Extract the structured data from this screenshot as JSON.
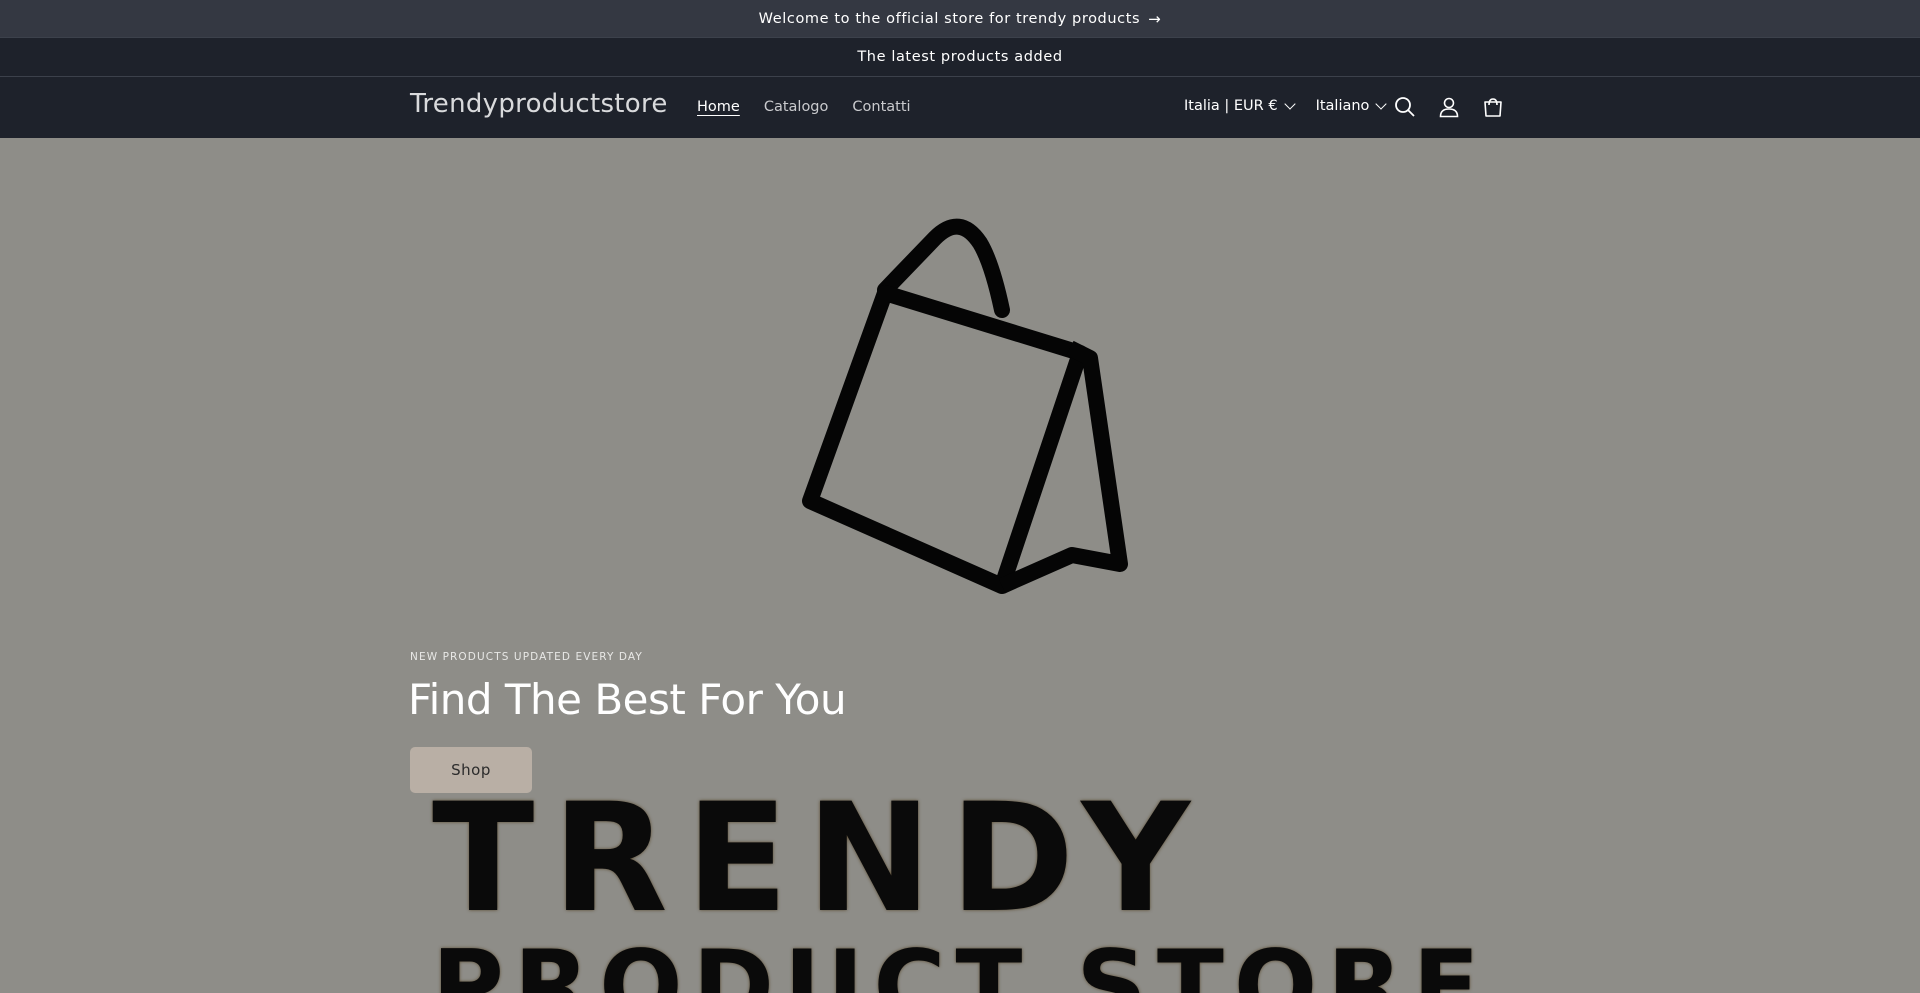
{
  "announcement": {
    "text": "Welcome to the official store for trendy products",
    "arrow": "→"
  },
  "subbar": {
    "text": "The latest products added"
  },
  "header": {
    "logo": "Trendyproductstore",
    "nav": [
      "Home",
      "Catalogo",
      "Contatti"
    ],
    "country_selector": "Italia | EUR €",
    "language_selector": "Italiano",
    "icons": [
      "search-icon",
      "account-icon",
      "cart-icon"
    ]
  },
  "hero": {
    "eyebrow": "NEW PRODUCTS UPDATED EVERY DAY",
    "headline": "Find The Best For You",
    "button": "Shop",
    "logo_line1": "TRENDY",
    "logo_line2": "PRODUCT STORE"
  },
  "colors": {
    "hero_bg": "#8e8d88",
    "header_bg": "#1e222b",
    "announcement_bg": "#343842",
    "button_bg": "#b9afa5"
  }
}
